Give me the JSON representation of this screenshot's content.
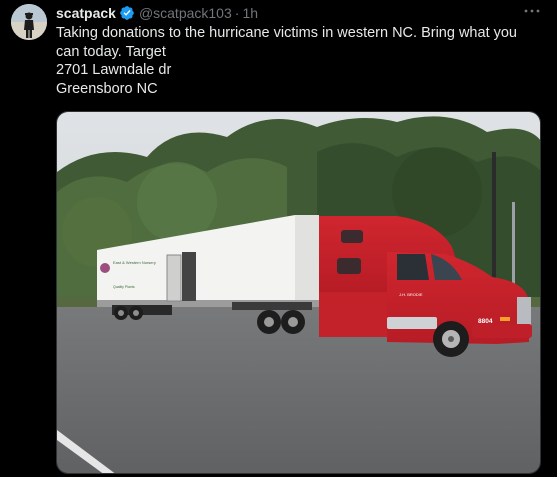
{
  "tweet": {
    "author": {
      "display_name": "scatpack",
      "handle": "@scatpack103",
      "verified": true,
      "avatar_icon": "profile-photo-icon"
    },
    "separator": "·",
    "timestamp": "1h",
    "more_icon": "more-dots-icon",
    "text_lines": [
      "Taking donations to the hurricane victims in western NC.  Bring what you",
      "can today. Target",
      "2701 Lawndale dr",
      "Greensboro NC"
    ],
    "media": {
      "truck_number": "8804",
      "cab_label": "J.H. BRODIE",
      "trailer_logo_text": "East & Western Nursery",
      "trailer_tagline": "Quality Plants"
    }
  },
  "colors": {
    "background": "#000000",
    "text_primary": "#e7e9ea",
    "text_secondary": "#71767b",
    "verified_badge": "#1d9bf0",
    "truck_red": "#c8202a"
  }
}
